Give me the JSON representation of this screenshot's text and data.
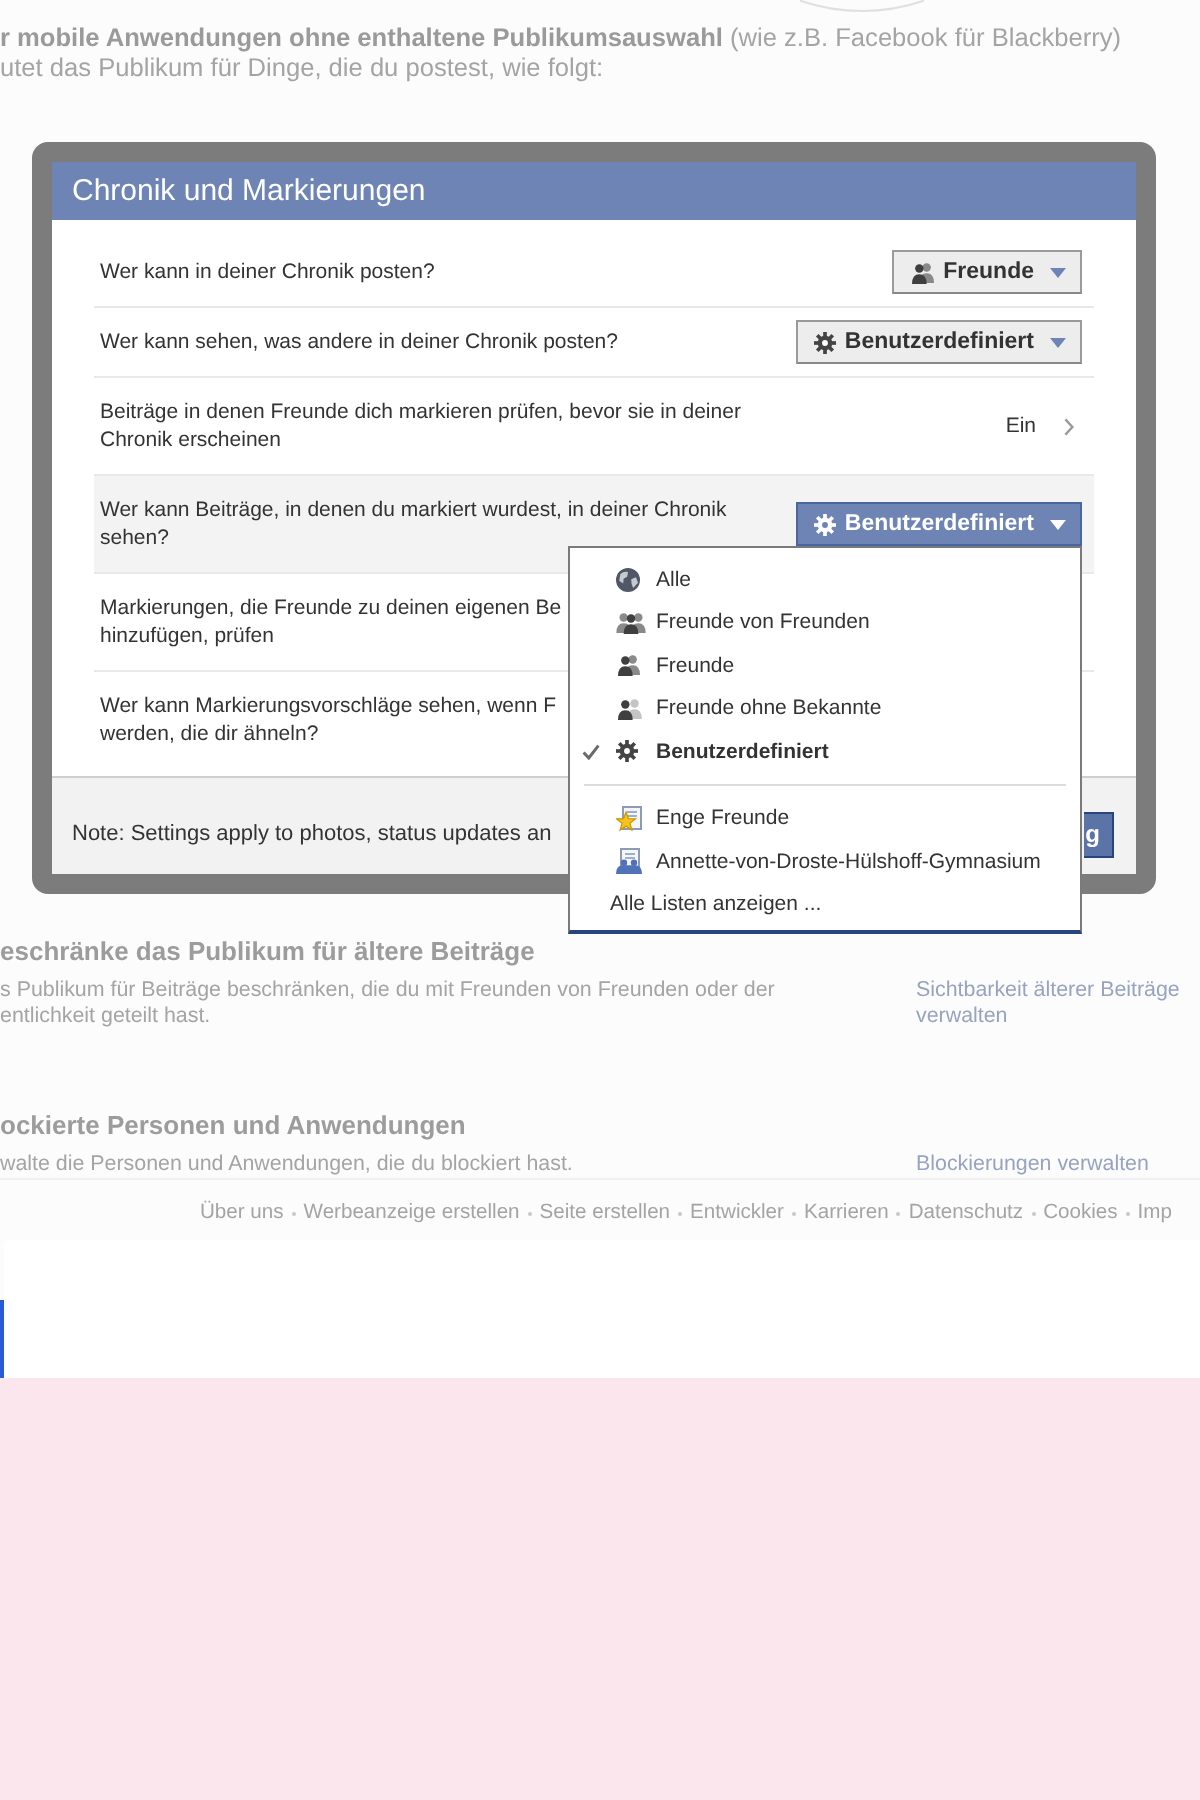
{
  "intro": {
    "lines": [
      "**r mobile Anwendungen ohne enthaltene Publikumsauswahl** (wie z.B. Facebook für Blackberry)",
      "utet das Publikum für Dinge, die du postest, wie folgt:"
    ]
  },
  "dialog": {
    "title": "Chronik und Markierungen",
    "rows": [
      {
        "kind": "select",
        "lines": [
          "Wer kann in deiner Chronik posten?"
        ],
        "control": {
          "kind": "friends",
          "label": "Freunde",
          "open": false
        }
      },
      {
        "kind": "select",
        "lines": [
          "Wer kann sehen, was andere in deiner Chronik posten?"
        ],
        "control": {
          "kind": "custom",
          "label": "Benutzerdefiniert",
          "open": false
        }
      },
      {
        "kind": "link",
        "lines": [
          "Beiträge in denen Freunde dich markieren prüfen, bevor sie in deiner",
          "Chronik erscheinen"
        ],
        "value": "Ein"
      },
      {
        "kind": "select",
        "lines": [
          "Wer kann Beiträge, in denen du markiert wurdest, in deiner Chronik",
          "sehen?"
        ],
        "control": {
          "kind": "custom",
          "label": "Benutzerdefiniert",
          "open": true,
          "options": [
            {
              "kind": "public",
              "label": "Alle",
              "selected": false
            },
            {
              "kind": "friendsoffriends",
              "label": "Freunde von Freunden",
              "selected": false
            },
            {
              "kind": "friends",
              "label": "Freunde",
              "selected": false
            },
            {
              "kind": "restricted",
              "label": "Freunde ohne Bekannte",
              "selected": false
            },
            {
              "kind": "custom",
              "label": "Benutzerdefiniert",
              "selected": true
            },
            {
              "kind": "separator"
            },
            {
              "kind": "closefriends",
              "label": "Enge Freunde",
              "selected": false
            },
            {
              "kind": "list",
              "label": "Annette-von-Droste-Hülshoff-Gymnasium",
              "selected": false
            },
            {
              "kind": "more",
              "label": "Alle Listen anzeigen ..."
            }
          ]
        }
      },
      {
        "kind": "plain",
        "lines": [
          "Markierungen, die Freunde zu deinen eigenen Be",
          "hinzufügen, prüfen"
        ]
      },
      {
        "kind": "plain",
        "lines": [
          "Wer kann Markierungsvorschläge sehen, wenn F",
          "werden, die dir ähneln?"
        ]
      }
    ],
    "note": "Note: Settings apply to photos, status updates an",
    "button": "g"
  },
  "sections": [
    {
      "title": "eschränke das Publikum für ältere Beiträge",
      "description": [
        "s Publikum für Beiträge beschränken, die du mit Freunden von Freunden oder der",
        "entlichkeit geteilt hast."
      ],
      "link": [
        "Sichtbarkeit älterer Beiträge",
        "verwalten"
      ]
    },
    {
      "title": "ockierte Personen und Anwendungen",
      "description": [
        "walte die Personen und Anwendungen, die du blockiert hast."
      ],
      "link": [
        "Blockierungen verwalten"
      ]
    }
  ],
  "footer": {
    "links": [
      "Über uns",
      "Werbeanzeige erstellen",
      "Seite erstellen",
      "Entwickler",
      "Karrieren",
      "Datenschutz",
      "Cookies",
      "Imp"
    ]
  }
}
